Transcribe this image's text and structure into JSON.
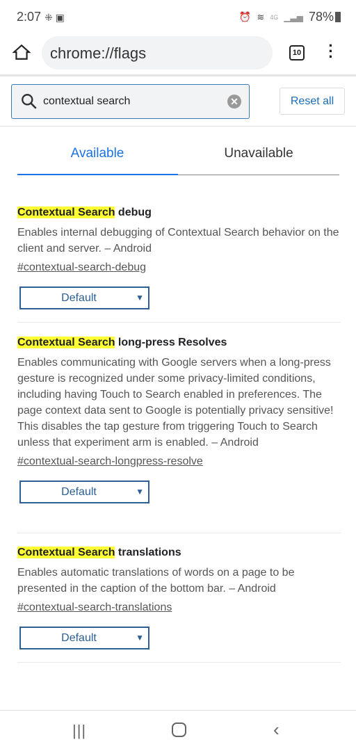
{
  "status_bar": {
    "time": "2:07",
    "battery": "78%",
    "network": "4G"
  },
  "toolbar": {
    "url": "chrome://flags",
    "tab_count": "10"
  },
  "search": {
    "value": "contextual search",
    "reset_label": "Reset all"
  },
  "tabs": [
    {
      "label": "Available",
      "active": true
    },
    {
      "label": "Unavailable",
      "active": false
    }
  ],
  "accent_color": "#1a73e8",
  "highlight_color": "#ffff33",
  "flags": [
    {
      "highlight": "Contextual Search",
      "title_rest": " debug",
      "description": "Enables internal debugging of Contextual Search behavior on the client and server. – Android",
      "link": "#contextual-search-debug",
      "select": "Default"
    },
    {
      "highlight": "Contextual Search",
      "title_rest": " long-press Resolves",
      "description": "Enables communicating with Google servers when a long-press gesture is recognized under some privacy-limited conditions, including having Touch to Search enabled in preferences. The page context data sent to Google is potentially privacy sensitive! This disables the tap gesture from triggering Touch to Search unless that experiment arm is enabled. – Android",
      "link": "#contextual-search-longpress-resolve",
      "select": "Default"
    },
    {
      "highlight": "Contextual Search",
      "title_rest": " translations",
      "description": "Enables automatic translations of words on a page to be presented in the caption of the bottom bar. – Android",
      "link": "#contextual-search-translations",
      "select": "Default"
    }
  ]
}
